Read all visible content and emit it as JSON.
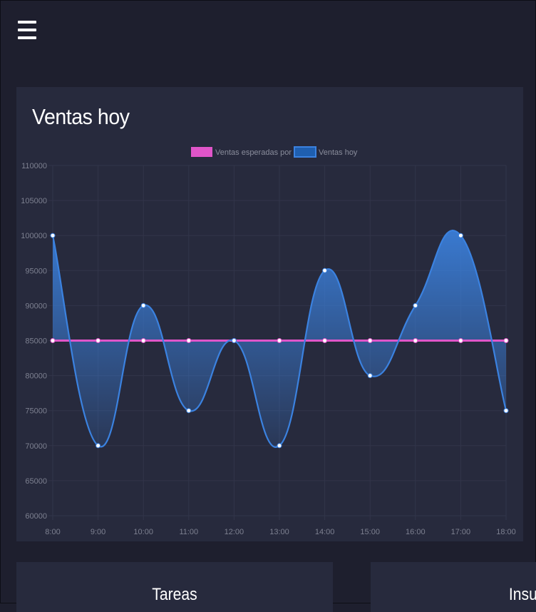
{
  "nav": {
    "menu_icon": "hamburger-menu-icon"
  },
  "sales_card": {
    "title": "Ventas hoy"
  },
  "tasks_card": {
    "title": "Tareas"
  },
  "supplies_card": {
    "title": "Insum"
  },
  "colors": {
    "background": "#1e1f2e",
    "card": "#272a3d",
    "expected_line": "#e055c9",
    "sales_line": "#3b82e0"
  },
  "chart_data": {
    "type": "line",
    "title": "",
    "xlabel": "",
    "ylabel": "",
    "categories": [
      "8:00",
      "9:00",
      "10:00",
      "11:00",
      "12:00",
      "13:00",
      "14:00",
      "15:00",
      "16:00",
      "17:00",
      "18:00"
    ],
    "ylim": [
      60000,
      110000
    ],
    "yticks": [
      110000,
      105000,
      100000,
      95000,
      90000,
      85000,
      80000,
      75000,
      70000,
      65000,
      60000
    ],
    "legend_position": "top",
    "grid": true,
    "series": [
      {
        "name": "Ventas esperadas por hora",
        "color": "#e055c9",
        "values": [
          85000,
          85000,
          85000,
          85000,
          85000,
          85000,
          85000,
          85000,
          85000,
          85000,
          85000
        ]
      },
      {
        "name": "Ventas hoy",
        "color": "#3b82e0",
        "fill": true,
        "values": [
          100000,
          70000,
          90000,
          75000,
          85000,
          70000,
          95000,
          80000,
          90000,
          100000,
          75000
        ]
      }
    ]
  }
}
